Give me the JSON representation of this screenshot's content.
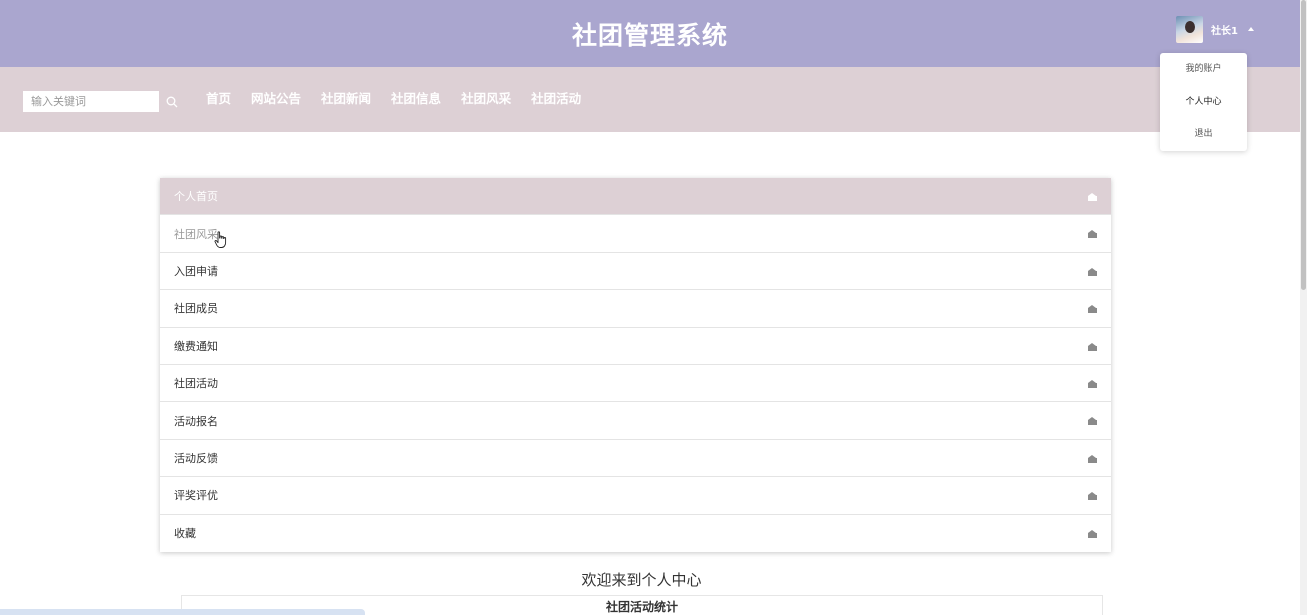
{
  "header": {
    "title": "社团管理系统",
    "user": {
      "name": "社长1"
    }
  },
  "navbar": {
    "search_placeholder": "输入关键词",
    "links": [
      "首页",
      "网站公告",
      "社团新闻",
      "社团信息",
      "社团风采",
      "社团活动"
    ]
  },
  "user_dropdown": {
    "items": [
      "我的账户",
      "个人中心",
      "退出"
    ]
  },
  "menu": {
    "items": [
      "个人首页",
      "社团风采",
      "入团申请",
      "社团成员",
      "缴费通知",
      "社团活动",
      "活动报名",
      "活动反馈",
      "评奖评优",
      "收藏"
    ]
  },
  "main": {
    "welcome": "欢迎来到个人中心",
    "stats_title": "社团活动统计"
  },
  "colors": {
    "header_bg": "#aaa6cf",
    "navbar_bg": "#ddd0d5",
    "menu_active_bg": "#ddd0d5"
  }
}
